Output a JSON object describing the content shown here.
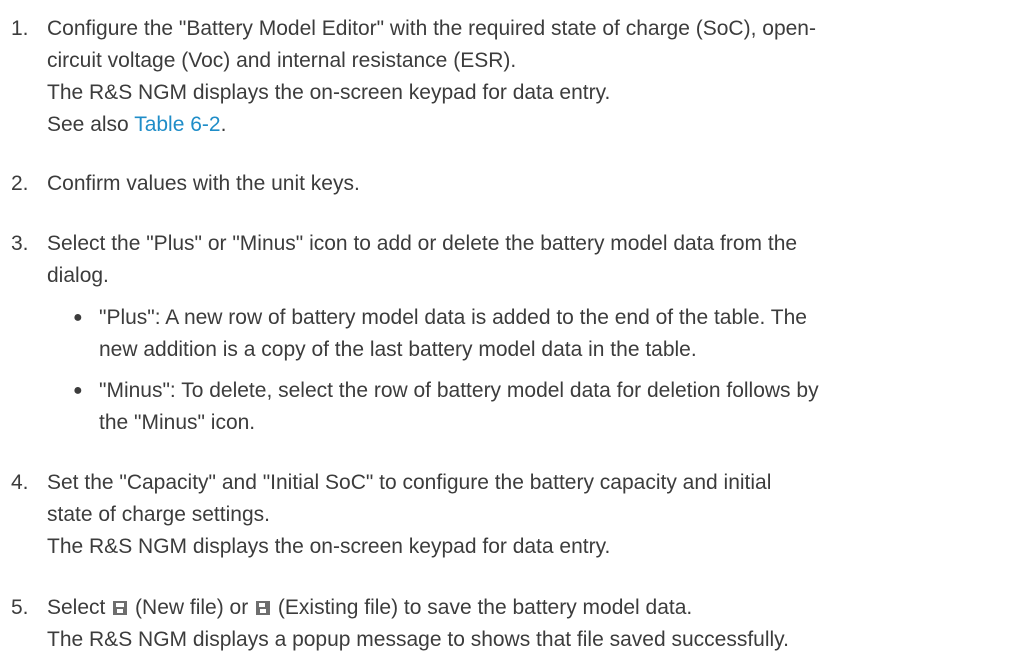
{
  "steps": [
    {
      "number": "1.",
      "lines": [
        "Configure the \"Battery Model Editor\" with the required state of charge (SoC), open-",
        "circuit voltage (Voc) and internal resistance (ESR).",
        "The R&S NGM displays the on-screen keypad for data entry."
      ],
      "see_also_prefix": "See also ",
      "see_also_link": "Table 6-2",
      "see_also_suffix": "."
    },
    {
      "number": "2.",
      "lines": [
        "Confirm values with the unit keys."
      ]
    },
    {
      "number": "3.",
      "lines": [
        "Select the \"Plus\" or \"Minus\" icon to add or delete the battery model data from the",
        "dialog."
      ],
      "bullet_glyph": "●",
      "bullets": [
        {
          "lines": [
            "\"Plus\": A new row of battery model data is added to the end of the table. The",
            "new addition is a copy of the last battery model data in the table."
          ]
        },
        {
          "lines": [
            "\"Minus\": To delete, select the row of battery model data for deletion follows by",
            "the \"Minus\" icon."
          ]
        }
      ]
    },
    {
      "number": "4.",
      "lines": [
        "Set the \"Capacity\" and \"Initial SoC\" to configure the battery capacity and initial",
        "state of charge settings.",
        "The R&S NGM displays the on-screen keypad for data entry."
      ]
    },
    {
      "number": "5.",
      "line1_part1": "Select ",
      "new_file_icon": "save-new-file-icon",
      "line1_part2": " (New file) or ",
      "existing_file_icon": "save-existing-file-icon",
      "line1_part3": " (Existing file) to save the battery model data.",
      "line2": "The R&S NGM displays a popup message to shows that file saved successfully."
    }
  ]
}
